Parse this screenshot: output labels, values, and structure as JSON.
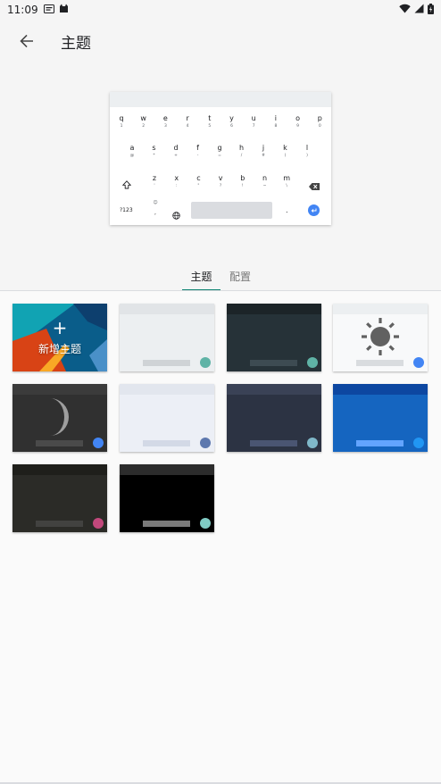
{
  "status_bar": {
    "time": "11:09",
    "icons": [
      "message-icon",
      "cat-notification-icon",
      "wifi-icon",
      "signal-icon",
      "battery-charging-icon"
    ]
  },
  "app_bar": {
    "title": "主题",
    "back_icon": "arrow-back-icon"
  },
  "keyboard_preview": {
    "row1": [
      {
        "key": "q",
        "hint": "1"
      },
      {
        "key": "w",
        "hint": "2"
      },
      {
        "key": "e",
        "hint": "3"
      },
      {
        "key": "r",
        "hint": "4"
      },
      {
        "key": "t",
        "hint": "5"
      },
      {
        "key": "y",
        "hint": "6"
      },
      {
        "key": "u",
        "hint": "7"
      },
      {
        "key": "i",
        "hint": "8"
      },
      {
        "key": "o",
        "hint": "9"
      },
      {
        "key": "p",
        "hint": "0"
      }
    ],
    "row2": [
      {
        "key": "a",
        "hint": "@"
      },
      {
        "key": "s",
        "hint": "*"
      },
      {
        "key": "d",
        "hint": "+"
      },
      {
        "key": "f",
        "hint": "-"
      },
      {
        "key": "g",
        "hint": "="
      },
      {
        "key": "h",
        "hint": "/"
      },
      {
        "key": "j",
        "hint": "#"
      },
      {
        "key": "k",
        "hint": "("
      },
      {
        "key": "l",
        "hint": ")"
      }
    ],
    "row3": [
      {
        "key": "z",
        "hint": "'"
      },
      {
        "key": "x",
        "hint": ":"
      },
      {
        "key": "c",
        "hint": "\""
      },
      {
        "key": "v",
        "hint": "?"
      },
      {
        "key": "b",
        "hint": "!"
      },
      {
        "key": "n",
        "hint": "~"
      },
      {
        "key": "m",
        "hint": "\\"
      }
    ],
    "symbols_key": "?123",
    "comma_key": ",",
    "period_key": ".",
    "shift_icon": "shift-icon",
    "backspace_icon": "backspace-icon",
    "globe_icon": "globe-icon",
    "enter_icon": "enter-icon"
  },
  "tabs": [
    {
      "label": "主题",
      "selected": true
    },
    {
      "label": "配置",
      "selected": false
    }
  ],
  "themes": {
    "add_label": "新增主题",
    "add_icon": "plus-icon",
    "tiles": [
      {
        "name": "light-gray",
        "bg": "#eceff1",
        "bar": "#e1e4e7",
        "space": "#cfd3d6",
        "dot": "#5fb3a6",
        "icon": ""
      },
      {
        "name": "dark-slate",
        "bg": "#263238",
        "bar": "#1c2428",
        "space": "#3d4b52",
        "dot": "#5fb3a6",
        "icon": ""
      },
      {
        "name": "light-sun",
        "bg": "#f8f9fa",
        "bar": "#eceff1",
        "space": "#d9dcdf",
        "dot": "#4285f4",
        "icon": "sun-icon"
      },
      {
        "name": "dark-moon",
        "bg": "#303030",
        "bar": "#3b3b3b",
        "space": "#4a4a4a",
        "dot": "#4285f4",
        "icon": "moon-icon"
      },
      {
        "name": "light-blue-gray",
        "bg": "#eceff6",
        "bar": "#e2e6ee",
        "space": "#d3d9e6",
        "dot": "#5d78ae",
        "icon": ""
      },
      {
        "name": "dark-navy",
        "bg": "#2c3343",
        "bar": "#3a4256",
        "space": "#4a5572",
        "dot": "#7fb8c9",
        "icon": ""
      },
      {
        "name": "material-blue",
        "bg": "#1565c0",
        "bar": "#0d47a1",
        "space": "#63a4ff",
        "dot": "#2196f3",
        "icon": ""
      },
      {
        "name": "dark-olive",
        "bg": "#2b2b27",
        "bar": "#1f1f1b",
        "space": "#424240",
        "dot": "#c2487c",
        "icon": ""
      },
      {
        "name": "pure-black",
        "bg": "#000000",
        "bar": "#2c2c2c",
        "space": "#7a7a7a",
        "dot": "#80cbc4",
        "icon": ""
      }
    ]
  }
}
